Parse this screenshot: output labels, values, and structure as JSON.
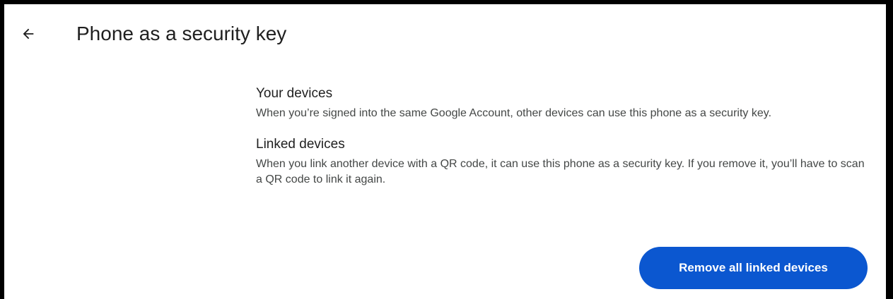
{
  "header": {
    "back_icon": "arrow-back-icon",
    "title": "Phone as a security key"
  },
  "sections": [
    {
      "title": "Your devices",
      "description": "When you’re signed into the same Google Account, other devices can use this phone as a security key."
    },
    {
      "title": "Linked devices",
      "description": "When you link another device with a QR code, it can use this phone as a security key. If you remove it, you’ll have to scan a QR code to link it again."
    }
  ],
  "actions": {
    "remove_label": "Remove all linked devices"
  },
  "colors": {
    "accent": "#0b57d0",
    "text_primary": "#1f1f1f",
    "text_secondary": "#444746"
  }
}
